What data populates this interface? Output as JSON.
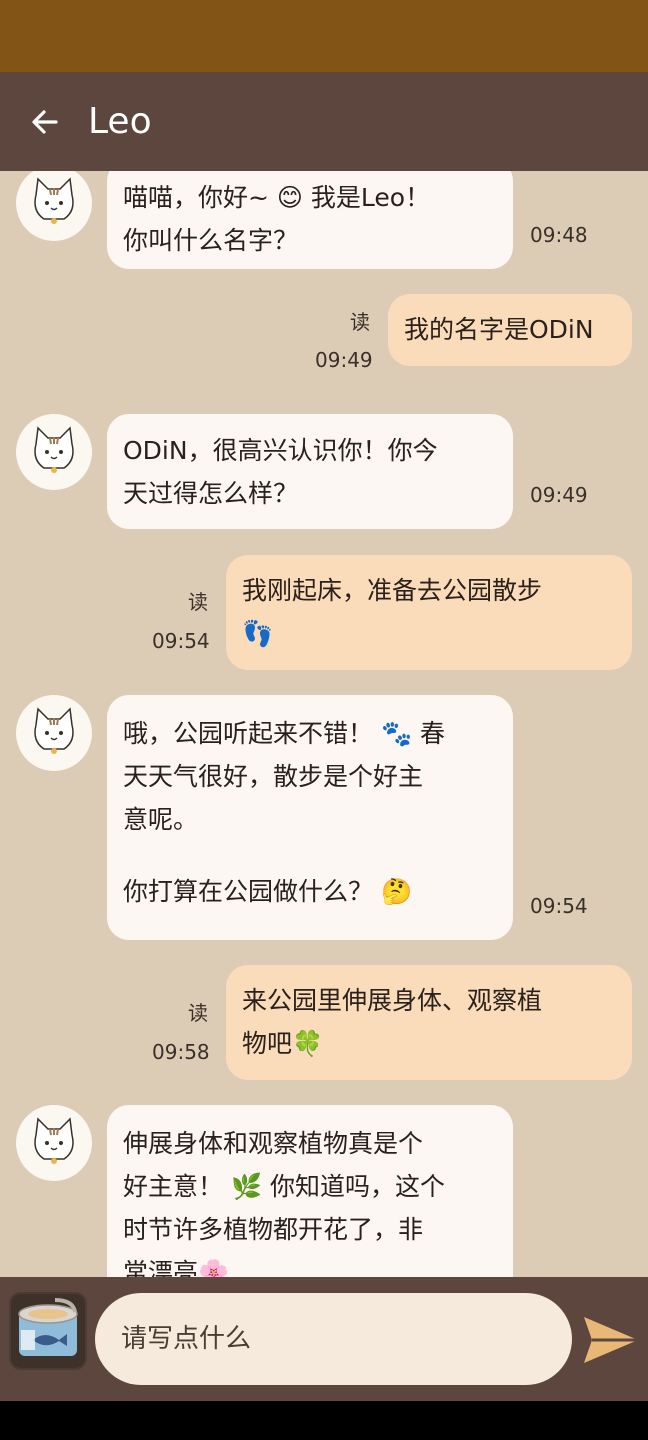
{
  "header": {
    "title": "Leo",
    "back_icon": "arrow-left-icon"
  },
  "messages": [
    {
      "from": "bot",
      "lines": [
        "喵喵，你好~ 😊 我是Leo！",
        "你叫什么名字？"
      ],
      "time": "09:48"
    },
    {
      "from": "user",
      "lines": [
        "我的名字是ODiN"
      ],
      "time": "09:49",
      "read": "读"
    },
    {
      "from": "bot",
      "lines": [
        "ODiN，很高兴认识你！你今",
        "天过得怎么样？"
      ],
      "time": "09:49"
    },
    {
      "from": "user",
      "lines": [
        "我刚起床，准备去公园散步",
        "👣"
      ],
      "time": "09:54",
      "read": "读"
    },
    {
      "from": "bot",
      "lines": [
        "哦，公园听起来不错！ 🐾 春",
        "天天气很好，散步是个好主",
        "意呢。",
        "",
        "你打算在公园做什么？ 🤔"
      ],
      "time": "09:54"
    },
    {
      "from": "user",
      "lines": [
        "来公园里伸展身体、观察植",
        "物吧🍀"
      ],
      "time": "09:58",
      "read": "读"
    },
    {
      "from": "bot",
      "lines": [
        "伸展身体和观察植物真是个",
        "好主意！ 🌿 你知道吗，这个",
        "时节许多植物都开花了，非",
        "常漂亮🌸"
      ]
    }
  ],
  "composer": {
    "placeholder": "请写点什么",
    "attach_icon": "tuna-can-icon",
    "send_icon": "send-icon"
  },
  "colors": {
    "status_bar": "#825516",
    "app_bar": "#5c463d",
    "chat_bg": "#dcccb6",
    "bubble_in": "#fcf7f2",
    "bubble_out": "#fbdcba",
    "send": "#e9b877"
  }
}
